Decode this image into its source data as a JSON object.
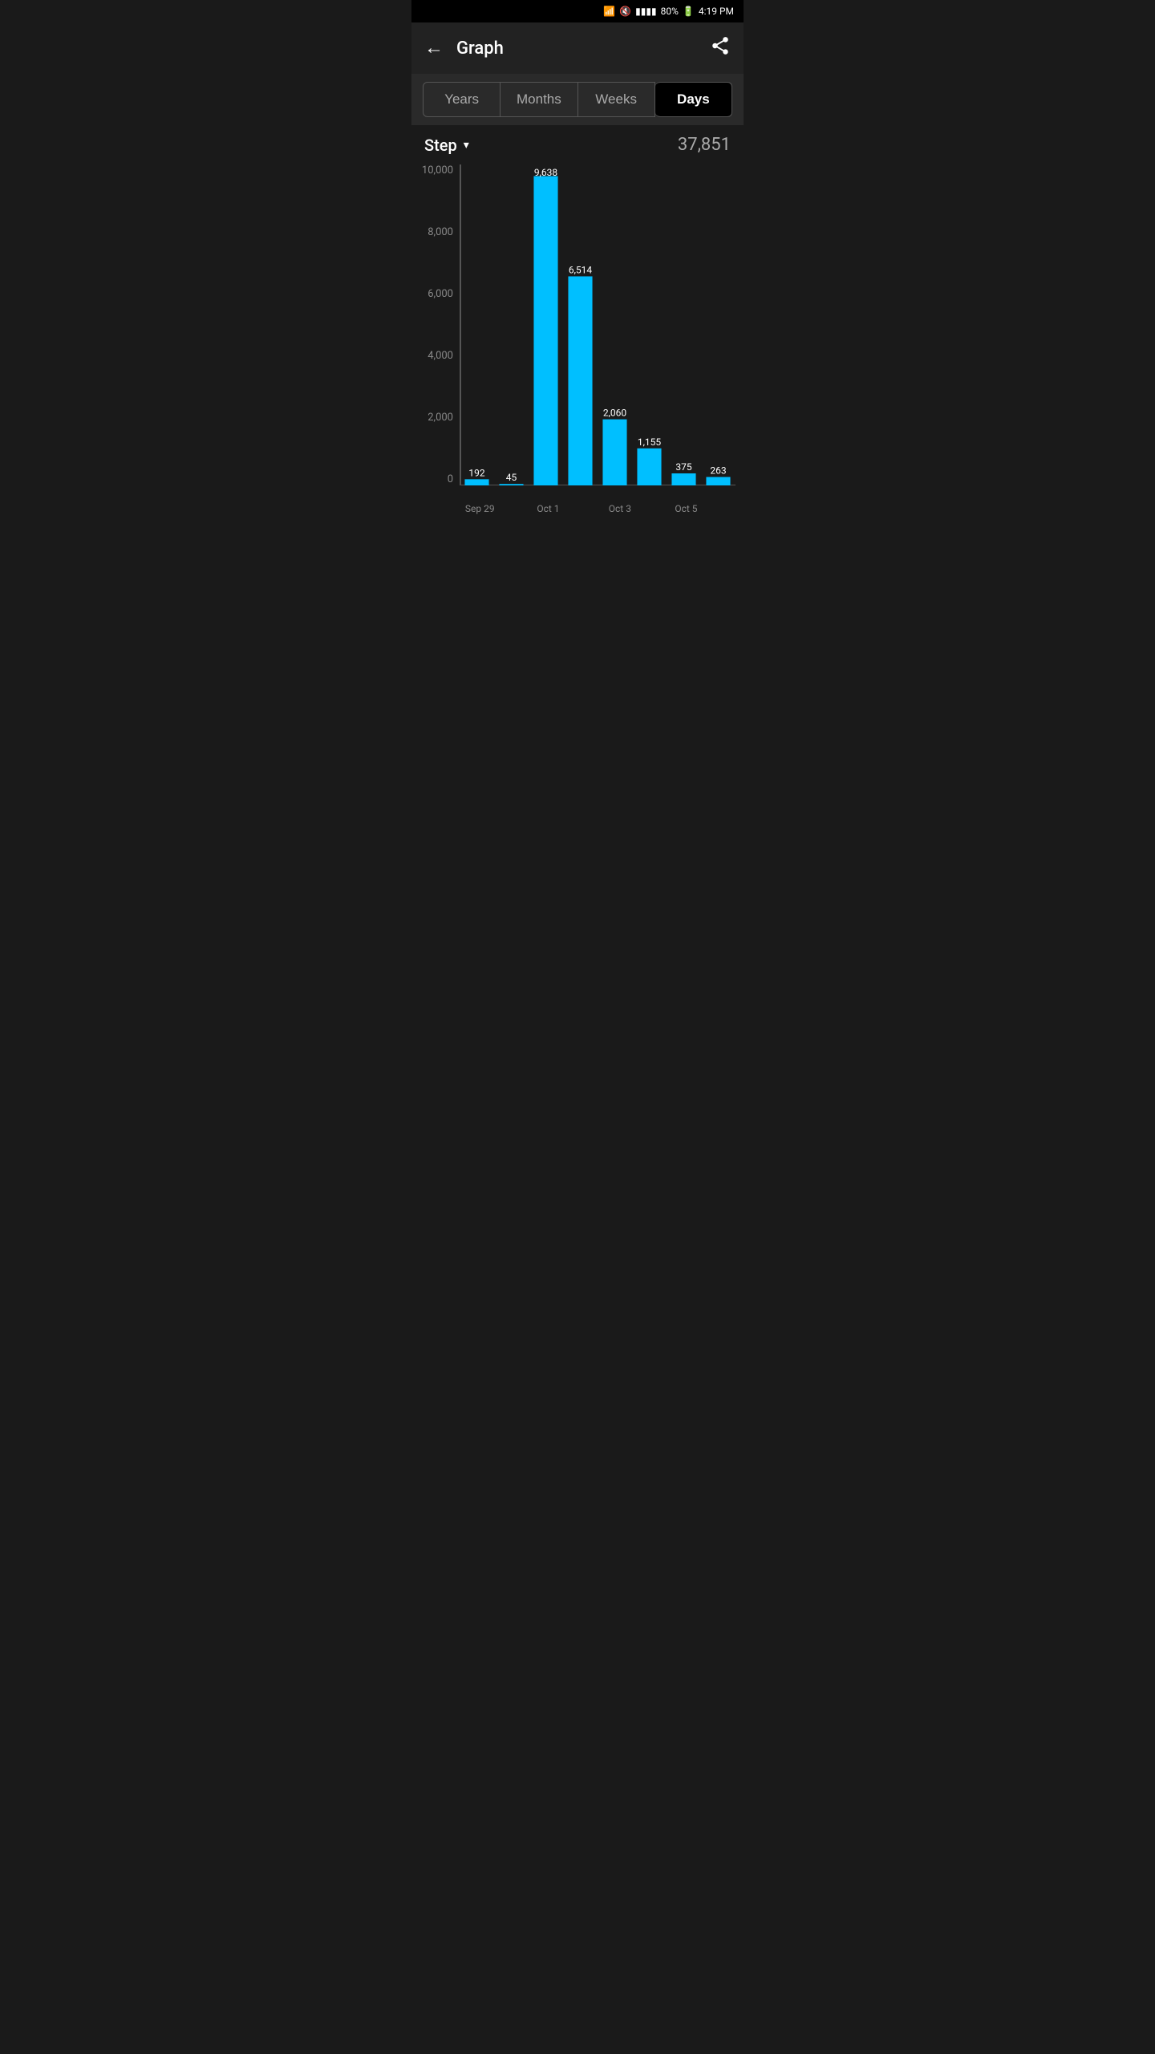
{
  "statusBar": {
    "time": "4:19 PM",
    "battery": "80%",
    "signal": "▮▮▮▮",
    "bluetoothIcon": "bluetooth",
    "muteIcon": "mute",
    "batteryIcon": "battery-charging"
  },
  "header": {
    "title": "Graph",
    "backLabel": "←",
    "shareLabel": "share"
  },
  "tabs": [
    {
      "id": "years",
      "label": "Years",
      "active": false
    },
    {
      "id": "months",
      "label": "Months",
      "active": false
    },
    {
      "id": "weeks",
      "label": "Weeks",
      "active": false
    },
    {
      "id": "days",
      "label": "Days",
      "active": true
    }
  ],
  "metric": {
    "label": "Step",
    "dropdownIcon": "▾",
    "totalValue": "37,851"
  },
  "chart": {
    "yAxisLabels": [
      "10,000",
      "8,000",
      "6,000",
      "4,000",
      "2,000",
      "0"
    ],
    "maxValue": 10000,
    "bars": [
      {
        "date": "Sep 29",
        "value": 192,
        "label": "192"
      },
      {
        "date": "",
        "value": 45,
        "label": "45"
      },
      {
        "date": "Oct 1",
        "value": 9638,
        "label": "9,638"
      },
      {
        "date": "",
        "value": 6514,
        "label": "6,514"
      },
      {
        "date": "Oct 3",
        "value": 2060,
        "label": "2,060"
      },
      {
        "date": "",
        "value": 1155,
        "label": "1,155"
      },
      {
        "date": "Oct 5",
        "value": 375,
        "label": "375"
      },
      {
        "date": "",
        "value": 263,
        "label": "263"
      }
    ],
    "xLabels": [
      {
        "label": "Sep 29",
        "position": 0
      },
      {
        "label": "Oct 1",
        "position": 2
      },
      {
        "label": "Oct 3",
        "position": 4
      },
      {
        "label": "Oct 5",
        "position": 6
      }
    ],
    "barColor": "#00BFFF"
  }
}
